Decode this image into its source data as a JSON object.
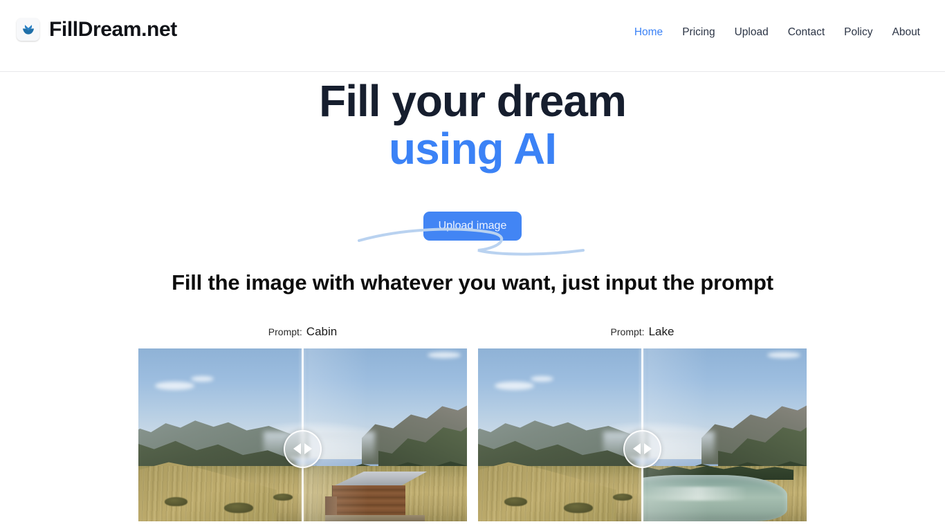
{
  "header": {
    "brand_name": "FillDream.net",
    "logo_icon": "leaf-chevron-logo",
    "nav": [
      {
        "label": "Home",
        "active": true
      },
      {
        "label": "Pricing",
        "active": false
      },
      {
        "label": "Upload",
        "active": false
      },
      {
        "label": "Contact",
        "active": false
      },
      {
        "label": "Policy",
        "active": false
      },
      {
        "label": "About",
        "active": false
      }
    ]
  },
  "hero": {
    "title_line1": "Fill your dream",
    "title_line2": "using AI",
    "cta_label": "Upload image",
    "accent_color": "#3b82f6",
    "title_color": "#161e2e",
    "underline_color": "#b9d2f0"
  },
  "section": {
    "heading": "Fill the image with whatever you want, just input the prompt"
  },
  "demos": [
    {
      "prompt_label": "Prompt:",
      "prompt_value": "Cabin",
      "scene": "alpine-mountain-meadow",
      "generated_object": "cabin",
      "slider_position_percent": 50
    },
    {
      "prompt_label": "Prompt:",
      "prompt_value": "Lake",
      "scene": "alpine-mountain-meadow",
      "generated_object": "lake",
      "slider_position_percent": 50
    }
  ]
}
